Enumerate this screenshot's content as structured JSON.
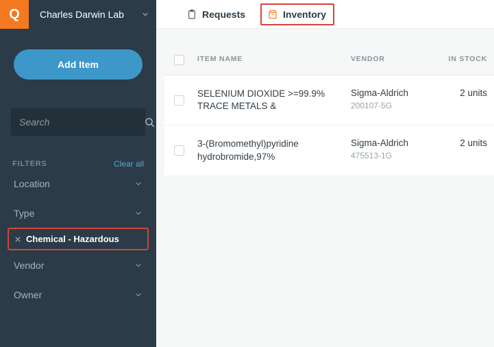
{
  "logo": "Q",
  "lab_name": "Charles Darwin Lab",
  "add_item_label": "Add Item",
  "search": {
    "placeholder": "Search"
  },
  "filters": {
    "title": "FILTERS",
    "clear_all": "Clear all",
    "items": [
      "Location",
      "Type",
      "Vendor",
      "Owner"
    ],
    "applied": "Chemical - Hazardous"
  },
  "tabs": {
    "requests": "Requests",
    "inventory": "Inventory"
  },
  "table": {
    "headers": {
      "name": "ITEM NAME",
      "vendor": "VENDOR",
      "stock": "IN STOCK"
    },
    "rows": [
      {
        "name": "SELENIUM DIOXIDE >=99.9% TRACE METALS &",
        "vendor": "Sigma-Aldrich",
        "vendor_sub": "200107-5G",
        "stock": "2 units"
      },
      {
        "name": "3-(Bromomethyl)pyridine hydrobromide,97%",
        "vendor": "Sigma-Aldrich",
        "vendor_sub": "475513-1G",
        "stock": "2 units"
      }
    ]
  }
}
